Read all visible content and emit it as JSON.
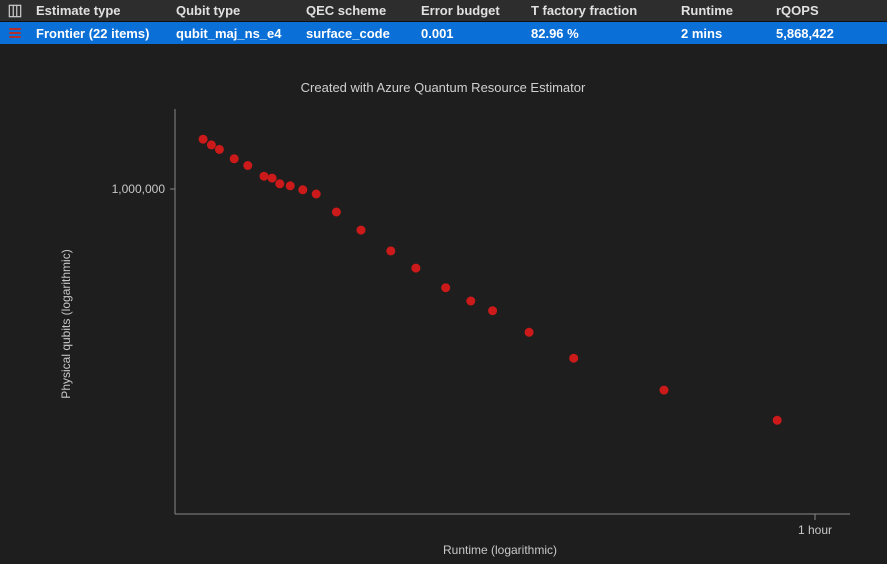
{
  "table": {
    "headers": {
      "estimate_type": "Estimate type",
      "qubit_type": "Qubit type",
      "qec_scheme": "QEC scheme",
      "error_budget": "Error budget",
      "t_factory_fraction": "T factory fraction",
      "runtime": "Runtime",
      "rqops": "rQOPS"
    },
    "row": {
      "estimate_type": "Frontier (22 items)",
      "qubit_type": "qubit_maj_ns_e4",
      "qec_scheme": "surface_code",
      "error_budget": "0.001",
      "t_factory_fraction": "82.96 %",
      "runtime": "2 mins",
      "rqops": "5,868,422"
    }
  },
  "chart_data": {
    "type": "scatter",
    "title": "Created with Azure Quantum Resource Estimator",
    "xlabel": "Runtime (logarithmic)",
    "ylabel": "Physical qubits (logarithmic)",
    "x_scale": "log",
    "y_scale": "log",
    "x_ticks": [
      {
        "value": 3600,
        "label": "1 hour"
      }
    ],
    "y_ticks": [
      {
        "value": 1000000,
        "label": "1,000,000"
      }
    ],
    "x_range_seconds": [
      80,
      5000
    ],
    "y_range_qubits": [
      60000,
      1200000
    ],
    "series": [
      {
        "name": "Frontier",
        "color": "#cc1a1a",
        "points": [
          {
            "runtime_s": 95,
            "qubits": 960000
          },
          {
            "runtime_s": 100,
            "qubits": 920000
          },
          {
            "runtime_s": 105,
            "qubits": 890000
          },
          {
            "runtime_s": 115,
            "qubits": 830000
          },
          {
            "runtime_s": 125,
            "qubits": 790000
          },
          {
            "runtime_s": 138,
            "qubits": 730000
          },
          {
            "runtime_s": 145,
            "qubits": 720000
          },
          {
            "runtime_s": 152,
            "qubits": 690000
          },
          {
            "runtime_s": 162,
            "qubits": 680000
          },
          {
            "runtime_s": 175,
            "qubits": 660000
          },
          {
            "runtime_s": 190,
            "qubits": 640000
          },
          {
            "runtime_s": 215,
            "qubits": 560000
          },
          {
            "runtime_s": 250,
            "qubits": 490000
          },
          {
            "runtime_s": 300,
            "qubits": 420000
          },
          {
            "runtime_s": 350,
            "qubits": 370000
          },
          {
            "runtime_s": 420,
            "qubits": 320000
          },
          {
            "runtime_s": 490,
            "qubits": 290000
          },
          {
            "runtime_s": 560,
            "qubits": 270000
          },
          {
            "runtime_s": 700,
            "qubits": 230000
          },
          {
            "runtime_s": 920,
            "qubits": 190000
          },
          {
            "runtime_s": 1600,
            "qubits": 150000
          },
          {
            "runtime_s": 3200,
            "qubits": 120000
          }
        ]
      }
    ]
  }
}
